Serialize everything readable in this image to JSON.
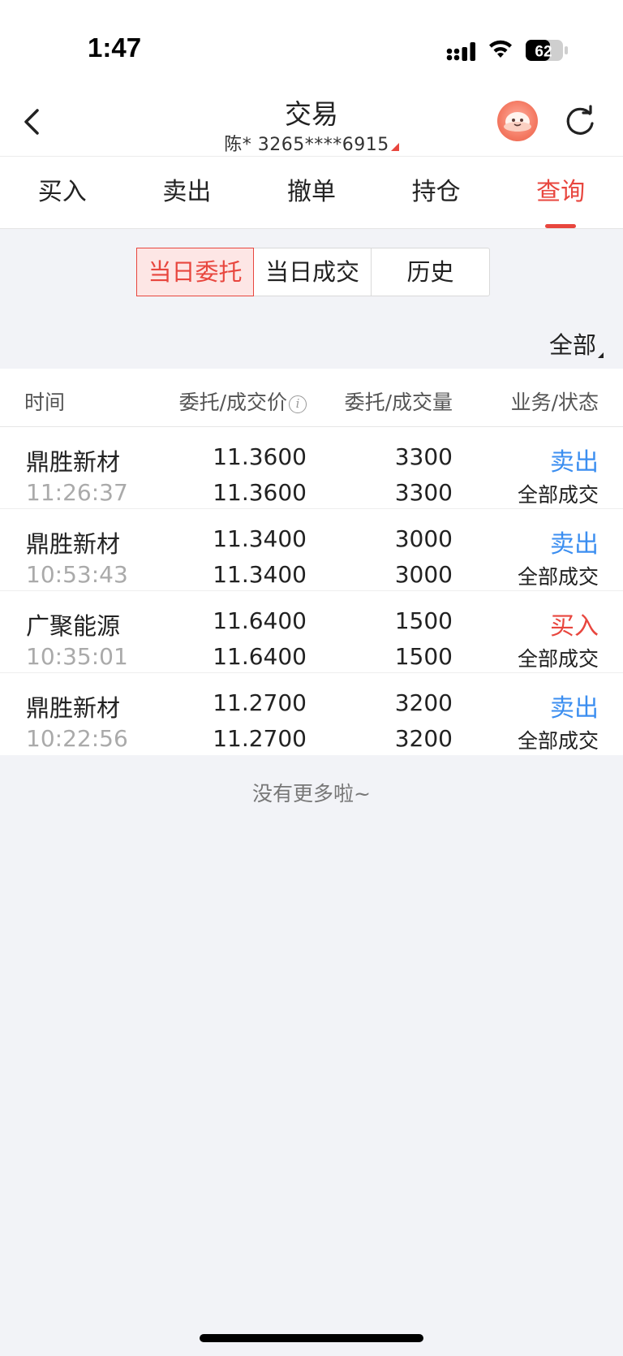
{
  "status_bar": {
    "time": "1:47",
    "battery": "62"
  },
  "header": {
    "title": "交易",
    "account": "陈* 3265****6915"
  },
  "tabs": [
    {
      "label": "买入",
      "active": false
    },
    {
      "label": "卖出",
      "active": false
    },
    {
      "label": "撤单",
      "active": false
    },
    {
      "label": "持仓",
      "active": false
    },
    {
      "label": "查询",
      "active": true
    }
  ],
  "segments": [
    {
      "label": "当日委托",
      "active": true
    },
    {
      "label": "当日成交",
      "active": false
    },
    {
      "label": "历史",
      "active": false
    }
  ],
  "filter": {
    "label": "全部"
  },
  "table": {
    "headers": {
      "time": "时间",
      "price": "委托/成交价",
      "qty": "委托/成交量",
      "status": "业务/状态"
    },
    "rows": [
      {
        "name": "鼎胜新材",
        "time": "11:26:37",
        "order_price": "11.3600",
        "fill_price": "11.3600",
        "order_qty": "3300",
        "fill_qty": "3300",
        "op": "卖出",
        "op_type": "sell",
        "status": "全部成交"
      },
      {
        "name": "鼎胜新材",
        "time": "10:53:43",
        "order_price": "11.3400",
        "fill_price": "11.3400",
        "order_qty": "3000",
        "fill_qty": "3000",
        "op": "卖出",
        "op_type": "sell",
        "status": "全部成交"
      },
      {
        "name": "广聚能源",
        "time": "10:35:01",
        "order_price": "11.6400",
        "fill_price": "11.6400",
        "order_qty": "1500",
        "fill_qty": "1500",
        "op": "买入",
        "op_type": "buy",
        "status": "全部成交"
      },
      {
        "name": "鼎胜新材",
        "time": "10:22:56",
        "order_price": "11.2700",
        "fill_price": "11.2700",
        "order_qty": "3200",
        "fill_qty": "3200",
        "op": "卖出",
        "op_type": "sell",
        "status": "全部成交"
      }
    ]
  },
  "footer": {
    "no_more": "没有更多啦~"
  },
  "colors": {
    "accent_red": "#e8463e",
    "sell_blue": "#3b8ef0",
    "background": "#f2f3f7"
  }
}
